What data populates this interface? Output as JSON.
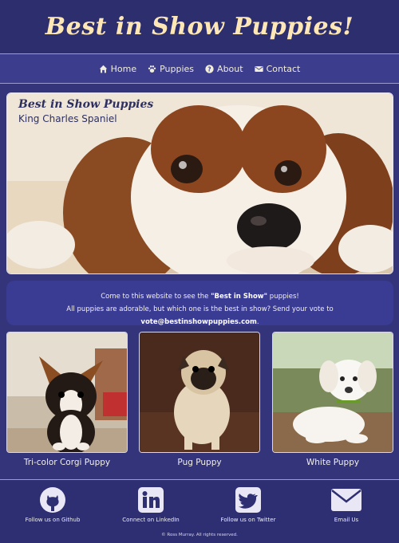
{
  "header": {
    "title": "Best in Show Puppies!"
  },
  "nav": {
    "items": [
      {
        "label": "Home",
        "icon": "home-icon"
      },
      {
        "label": "Puppies",
        "icon": "paw-icon"
      },
      {
        "label": "About",
        "icon": "question-circle-icon"
      },
      {
        "label": "Contact",
        "icon": "envelope-icon"
      }
    ]
  },
  "hero": {
    "title": "Best in Show Puppies",
    "subtitle": "King Charles Spaniel"
  },
  "intro": {
    "line1_pre": "Come to this website to see the ",
    "line1_bold": "\"Best in Show\"",
    "line1_post": " puppies!",
    "line2_pre": "All puppies are adorable, but which one is the best in show? Send your vote to ",
    "line2_email": "vote@bestinshowpuppies.com",
    "line2_post": "."
  },
  "puppies": [
    {
      "caption": "Tri-color Corgi Puppy"
    },
    {
      "caption": "Pug Puppy"
    },
    {
      "caption": "White Puppy"
    }
  ],
  "footer": {
    "links": [
      {
        "label": "Follow us on Github",
        "icon": "github-icon"
      },
      {
        "label": "Connect on LinkedIn",
        "icon": "linkedin-icon"
      },
      {
        "label": "Follow us on Twitter",
        "icon": "twitter-icon"
      },
      {
        "label": "Email Us",
        "icon": "envelope-icon"
      }
    ],
    "copyright": "© Ross Murray. All rights reserved."
  },
  "colors": {
    "background": "#34347a",
    "header": "#2d2e6e",
    "title": "#fde7b7",
    "panel": "#3a3b93"
  }
}
